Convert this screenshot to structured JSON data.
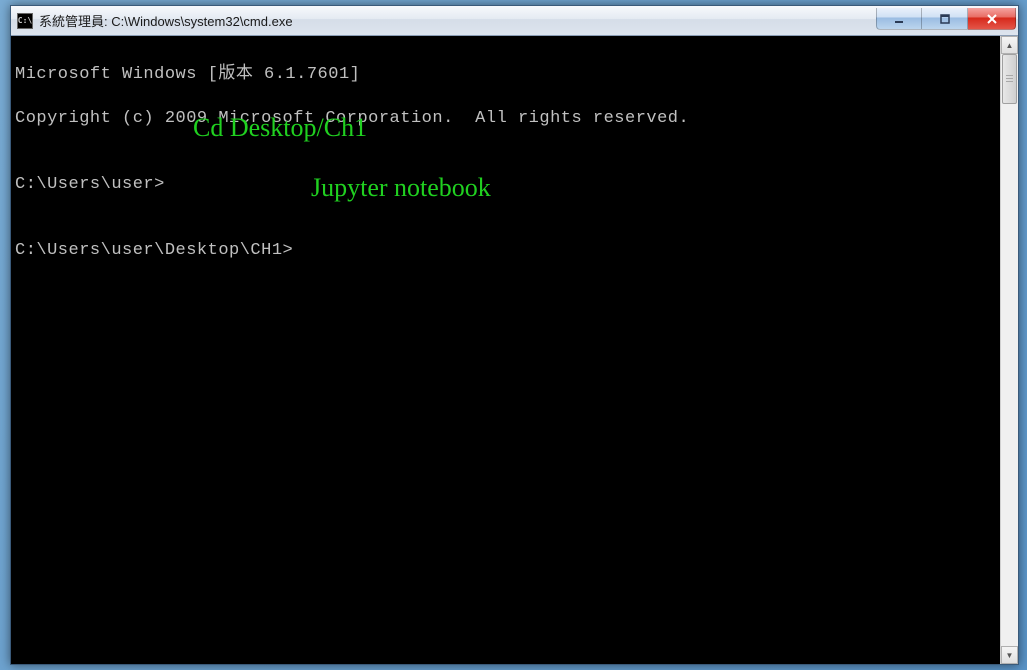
{
  "window": {
    "title": "系統管理員: C:\\Windows\\system32\\cmd.exe",
    "icon_label": "C:\\"
  },
  "console": {
    "line1": "Microsoft Windows [版本 6.1.7601]",
    "line2": "Copyright (c) 2009 Microsoft Corporation.  All rights reserved.",
    "blank": "",
    "prompt1": "C:\\Users\\user>",
    "prompt2": "C:\\Users\\user\\Desktop\\CH1>"
  },
  "annotations": {
    "cmd1": "Cd  Desktop/Ch1",
    "cmd2": "Jupyter notebook"
  }
}
